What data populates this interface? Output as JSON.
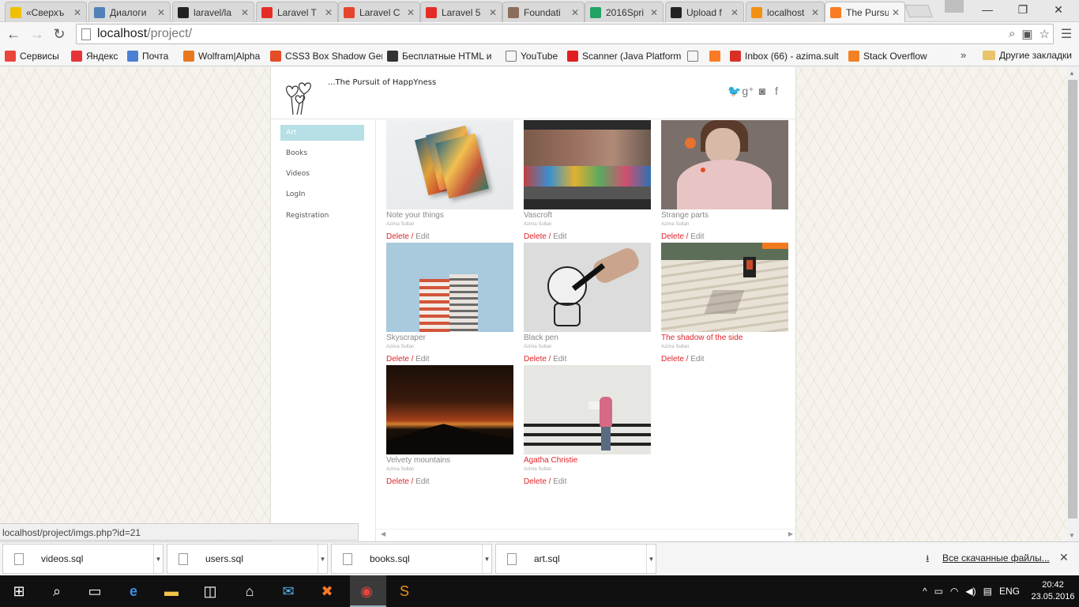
{
  "browser": {
    "tabs": [
      {
        "label": "«Сверхъ",
        "color": "#f0c000"
      },
      {
        "label": "Диалоги",
        "color": "#5181b8"
      },
      {
        "label": "laravel/la",
        "color": "#222222"
      },
      {
        "label": "Laravel T",
        "color": "#e52d27"
      },
      {
        "label": "Laravel C",
        "color": "#e74430"
      },
      {
        "label": "Laravel 5",
        "color": "#e52d27"
      },
      {
        "label": "Foundati",
        "color": "#8a6d5a"
      },
      {
        "label": "2016Spri",
        "color": "#21a366"
      },
      {
        "label": "Upload f",
        "color": "#222222"
      },
      {
        "label": "localhost",
        "color": "#f29111"
      },
      {
        "label": "The Pursu",
        "color": "#fb7a24"
      }
    ],
    "url_host": "localhost",
    "url_path": "/project/",
    "bookmarks": [
      {
        "label": "Сервисы",
        "color": "#e9453a"
      },
      {
        "label": "Яндекс",
        "color": "#e4343a"
      },
      {
        "label": "Почта",
        "color": "#4a7fd2"
      },
      {
        "label": "Wolfram|Alpha",
        "color": "#e8781e"
      },
      {
        "label": "CSS3 Box Shadow Ger",
        "color": "#e44d26"
      },
      {
        "label": "Бесплатные HTML и",
        "color": "#333333"
      },
      {
        "label": "YouTube",
        "color": "#ffffff"
      },
      {
        "label": "Scanner (Java Platform",
        "color": "#e02020"
      },
      {
        "label": "",
        "color": "#ffffff"
      },
      {
        "label": "",
        "color": "#fb7a24"
      },
      {
        "label": "Inbox (66) - azima.sult",
        "color": "#d93025"
      },
      {
        "label": "Stack Overflow",
        "color": "#f48024"
      }
    ],
    "bookmarks_more": "»",
    "other_bookmarks": "Другие закладки",
    "status_url": "localhost/project/imgs.php?id=21"
  },
  "site": {
    "tagline": "...The Pursuit of HappYness",
    "social": [
      "twitter-icon",
      "google-plus-icon",
      "instagram-icon",
      "facebook-icon"
    ],
    "nav": [
      {
        "label": "Art",
        "active": true
      },
      {
        "label": "Books",
        "active": false
      },
      {
        "label": "Videos",
        "active": false
      },
      {
        "label": "LogIn",
        "active": false
      },
      {
        "label": "Registration",
        "active": false
      }
    ],
    "delete_label": "Delete",
    "separator": " / ",
    "edit_label": "Edit",
    "cards": [
      {
        "title": "Note your things",
        "author": "Azima Sultan",
        "highlight": false
      },
      {
        "title": "Vascroft",
        "author": "Azima Sultan",
        "highlight": false
      },
      {
        "title": "Strange parts",
        "author": "Azima Sultan",
        "highlight": false
      },
      {
        "title": "Skyscraper",
        "author": "Azima Sultan",
        "highlight": false
      },
      {
        "title": "Black pen",
        "author": "Azima Sultan",
        "highlight": false
      },
      {
        "title": "The shadow of the side",
        "author": "Azima Sultan",
        "highlight": true
      },
      {
        "title": "Velvety mountains",
        "author": "Azima Sultan",
        "highlight": false
      },
      {
        "title": "Agatha Christie",
        "author": "Azima Sultan",
        "highlight": true
      }
    ]
  },
  "downloads": {
    "files": [
      "videos.sql",
      "users.sql",
      "books.sql",
      "art.sql"
    ],
    "all_label": "Все скачанные файлы..."
  },
  "taskbar": {
    "lang": "ENG",
    "time": "20:42",
    "date": "23.05.2016"
  }
}
